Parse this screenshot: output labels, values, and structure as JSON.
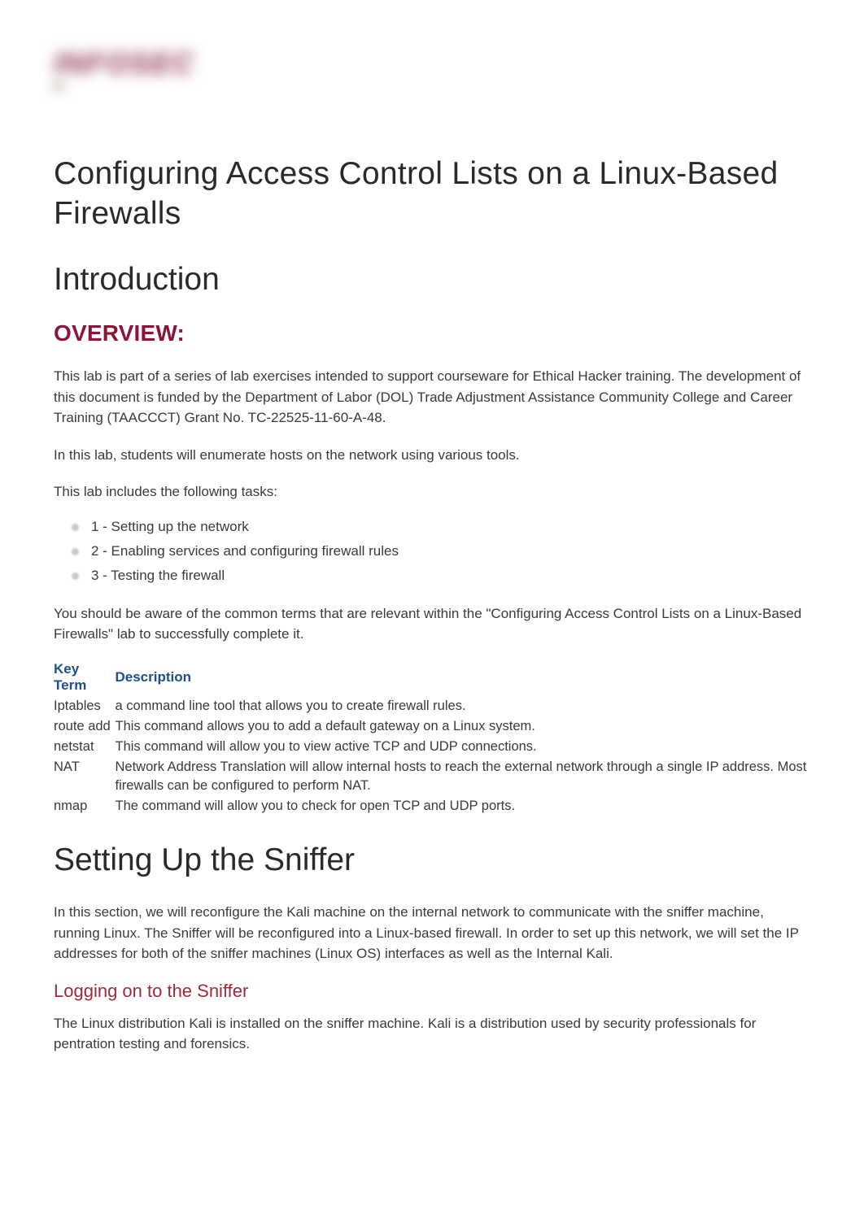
{
  "logo": {
    "top": "INFOSEC",
    "bottom": ""
  },
  "title": "Configuring Access Control Lists on a Linux-Based Firewalls",
  "intro_heading": "Introduction",
  "overview_heading": "OVERVIEW:",
  "overview_p1": "This lab is part of a series of lab exercises intended to support courseware for Ethical Hacker training. The development of this document is funded by the Department of Labor (DOL) Trade Adjustment Assistance Community College and Career Training (TAACCCT) Grant No. TC-22525-11-60-A-48.",
  "overview_p2": "In this lab, students will enumerate hosts on the network using various tools.",
  "tasks_intro": "This lab includes the following tasks:",
  "tasks": [
    "1 - Setting up the network",
    "2 - Enabling services and configuring firewall rules",
    "3 - Testing the firewall"
  ],
  "tasks_outro": "You should be aware of the common terms that are relevant within the \"Configuring Access Control Lists on a Linux-Based Firewalls\" lab to successfully complete it.",
  "table": {
    "headers": [
      "Key Term",
      "Description"
    ],
    "rows": [
      {
        "key": "Iptables",
        "desc": "a command line tool that allows you to create firewall rules."
      },
      {
        "key": "route add",
        "desc": "This command allows you to add a default gateway on a Linux system."
      },
      {
        "key": "netstat",
        "desc": "This command will allow you to view active TCP and UDP connections."
      },
      {
        "key": "NAT",
        "desc": "Network Address Translation will allow internal hosts to reach the external network through a single IP address. Most firewalls can be configured to perform NAT."
      },
      {
        "key": "nmap",
        "desc": "The command will allow you to check for open TCP and UDP ports."
      }
    ]
  },
  "sniffer_heading": "Setting Up the Sniffer",
  "sniffer_p": "In this section, we will reconfigure the Kali machine on the internal network to communicate with the sniffer machine, running Linux. The Sniffer will be reconfigured into a Linux-based firewall. In order to set up this network, we will set the IP addresses for both of the sniffer machines (Linux OS) interfaces as well as the Internal Kali.",
  "logging_heading": "Logging on to the Sniffer",
  "logging_p": "The Linux distribution Kali is installed on the sniffer machine. Kali is a distribution used by security professionals for pentration testing and forensics."
}
